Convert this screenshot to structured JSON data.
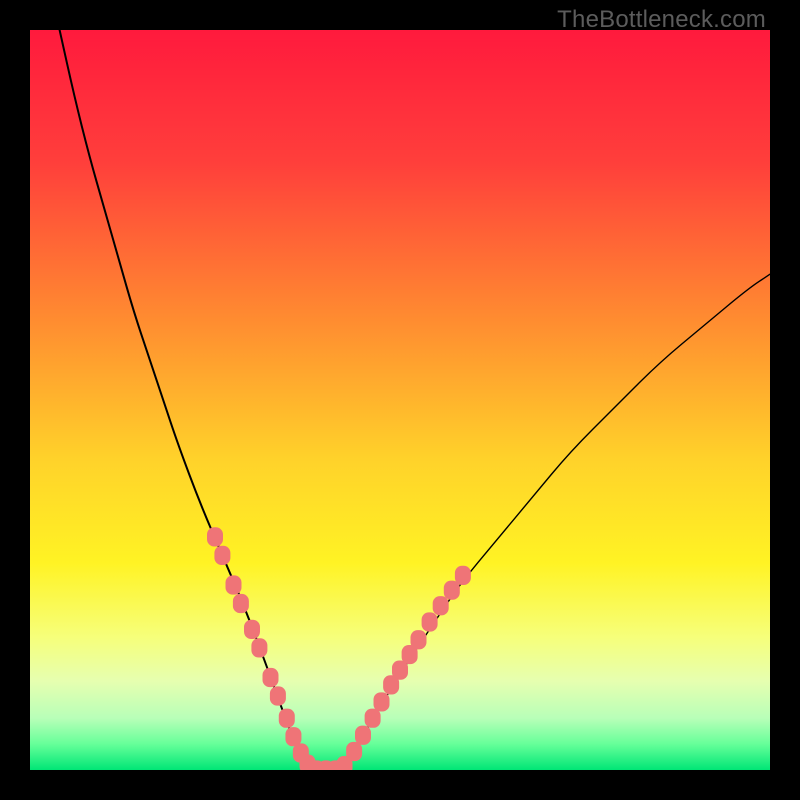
{
  "watermark": {
    "text": "TheBottleneck.com"
  },
  "chart_data": {
    "type": "line",
    "title": "",
    "xlabel": "",
    "ylabel": "",
    "xlim": [
      0,
      100
    ],
    "ylim": [
      0,
      100
    ],
    "grid": false,
    "legend": false,
    "gradient_stops": [
      {
        "offset": 0.0,
        "color": "#ff1a3d"
      },
      {
        "offset": 0.18,
        "color": "#ff3f3b"
      },
      {
        "offset": 0.4,
        "color": "#ff8f30"
      },
      {
        "offset": 0.58,
        "color": "#ffd22a"
      },
      {
        "offset": 0.72,
        "color": "#fff324"
      },
      {
        "offset": 0.82,
        "color": "#f6ff7a"
      },
      {
        "offset": 0.88,
        "color": "#e6ffb0"
      },
      {
        "offset": 0.93,
        "color": "#b8ffb8"
      },
      {
        "offset": 0.965,
        "color": "#66ff99"
      },
      {
        "offset": 1.0,
        "color": "#00e676"
      }
    ],
    "series": [
      {
        "name": "left-branch",
        "stroke": "#000000",
        "stroke_width": 2.0,
        "x": [
          4,
          6,
          8,
          10,
          12,
          14,
          16,
          18,
          20,
          23,
          26,
          29,
          32,
          34.5,
          36.5,
          37.5
        ],
        "y": [
          100,
          91,
          83,
          76,
          69,
          62,
          56,
          50,
          44,
          36,
          29,
          22,
          14,
          7,
          2,
          0
        ]
      },
      {
        "name": "right-branch",
        "stroke": "#000000",
        "stroke_width": 1.4,
        "x": [
          42,
          44,
          47,
          50,
          54,
          58,
          63,
          68,
          73,
          79,
          85,
          91,
          97,
          100
        ],
        "y": [
          0,
          3,
          8,
          13,
          19,
          25,
          31,
          37,
          43,
          49,
          55,
          60,
          65,
          67
        ]
      },
      {
        "name": "valley-floor",
        "stroke": "#000000",
        "stroke_width": 2.0,
        "x": [
          37.5,
          39,
          40.5,
          42
        ],
        "y": [
          0,
          0,
          0,
          0
        ]
      }
    ],
    "scatter_clusters": [
      {
        "name": "left-dots",
        "color": "#ef7477",
        "r": 8,
        "points": [
          {
            "x": 25.0,
            "y": 31.5
          },
          {
            "x": 26.0,
            "y": 29.0
          },
          {
            "x": 27.5,
            "y": 25.0
          },
          {
            "x": 28.5,
            "y": 22.5
          },
          {
            "x": 30.0,
            "y": 19.0
          },
          {
            "x": 31.0,
            "y": 16.5
          },
          {
            "x": 32.5,
            "y": 12.5
          },
          {
            "x": 33.5,
            "y": 10.0
          },
          {
            "x": 34.7,
            "y": 7.0
          },
          {
            "x": 35.6,
            "y": 4.5
          },
          {
            "x": 36.6,
            "y": 2.3
          },
          {
            "x": 37.5,
            "y": 0.8
          },
          {
            "x": 38.7,
            "y": 0.0
          },
          {
            "x": 40.0,
            "y": 0.0
          },
          {
            "x": 41.3,
            "y": 0.0
          }
        ]
      },
      {
        "name": "right-dots",
        "color": "#ef7477",
        "r": 8,
        "points": [
          {
            "x": 42.5,
            "y": 0.6
          },
          {
            "x": 43.8,
            "y": 2.5
          },
          {
            "x": 45.0,
            "y": 4.7
          },
          {
            "x": 46.3,
            "y": 7.0
          },
          {
            "x": 47.5,
            "y": 9.2
          },
          {
            "x": 48.8,
            "y": 11.5
          },
          {
            "x": 50.0,
            "y": 13.5
          },
          {
            "x": 51.3,
            "y": 15.6
          },
          {
            "x": 52.5,
            "y": 17.6
          },
          {
            "x": 54.0,
            "y": 20.0
          },
          {
            "x": 55.5,
            "y": 22.2
          },
          {
            "x": 57.0,
            "y": 24.3
          },
          {
            "x": 58.5,
            "y": 26.3
          }
        ]
      }
    ]
  }
}
